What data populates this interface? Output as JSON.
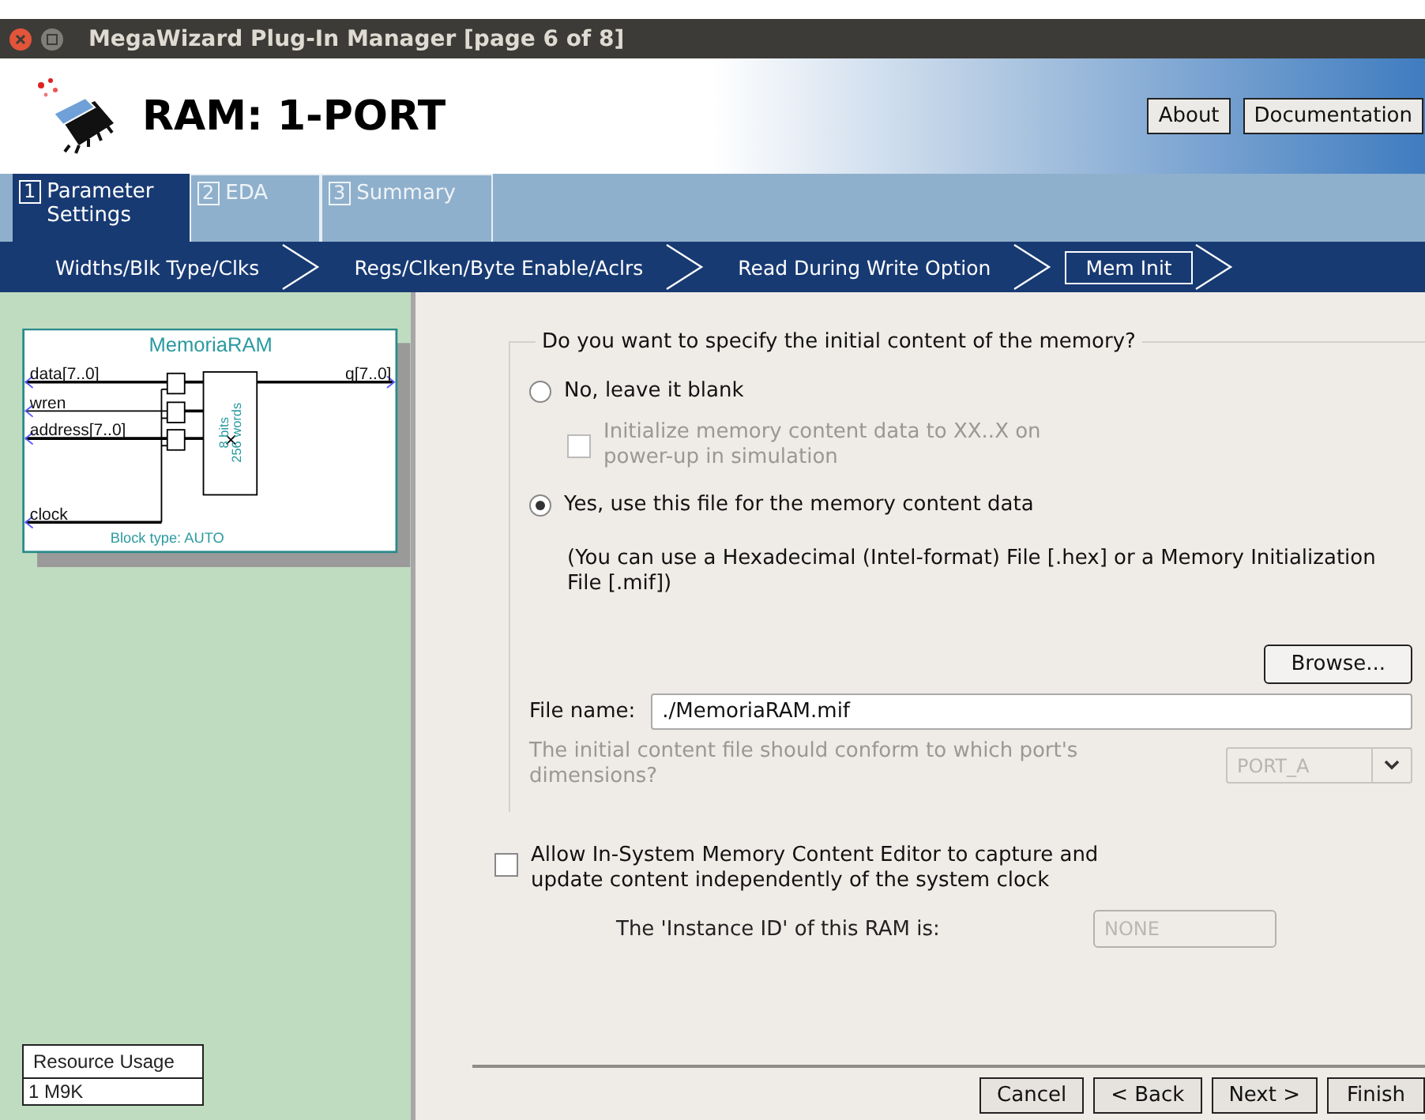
{
  "window": {
    "title": "MegaWizard Plug-In Manager [page 6 of 8]"
  },
  "header": {
    "title": "RAM: 1-PORT",
    "buttons": [
      "About",
      "Documentation"
    ]
  },
  "tabs": [
    {
      "number": "1",
      "label": "Parameter Settings",
      "selected": true
    },
    {
      "number": "2",
      "label": "EDA",
      "selected": false
    },
    {
      "number": "3",
      "label": "Summary",
      "selected": false
    }
  ],
  "steps": [
    {
      "label": "Widths/Blk Type/Clks",
      "selected": false
    },
    {
      "label": "Regs/Clken/Byte Enable/Aclrs",
      "selected": false
    },
    {
      "label": "Read During Write Option",
      "selected": false
    },
    {
      "label": "Mem Init",
      "selected": true
    }
  ],
  "diagram": {
    "title": "MemoriaRAM",
    "inputs": [
      "data[7..0]",
      "wren",
      "address[7..0]",
      "clock"
    ],
    "output": "q[7..0]",
    "block_lines": [
      "8 bits",
      "256 words"
    ],
    "block_type": "Block type: AUTO"
  },
  "resource_usage": {
    "heading": "Resource Usage",
    "value": "1 M9K"
  },
  "memory_init": {
    "question": "Do you want to specify the initial content of the memory?",
    "options": [
      {
        "label": "No, leave it blank",
        "selected": false
      },
      {
        "label": "Yes, use this file for the memory content data",
        "selected": true
      }
    ],
    "blank_checkbox": {
      "label": "Initialize memory content data to XX..X on power-up in simulation",
      "checked": false,
      "disabled": true
    },
    "file_hint": "(You can use a Hexadecimal (Intel-format) File [.hex] or a Memory Initialization File [.mif])",
    "browse": "Browse...",
    "file_label": "File name:",
    "file_value": "./MemoriaRAM.mif",
    "port_question": "The initial content file should conform to which port's dimensions?",
    "port_value": "PORT_A",
    "port_disabled": true
  },
  "editor_checkbox": {
    "label": "Allow In-System Memory Content Editor to capture and update content independently of the system clock",
    "checked": false
  },
  "instance": {
    "label": "The 'Instance ID' of this RAM is:",
    "value": "NONE",
    "disabled": true
  },
  "buttons": [
    "Cancel",
    "< Back",
    "Next >",
    "Finish"
  ]
}
